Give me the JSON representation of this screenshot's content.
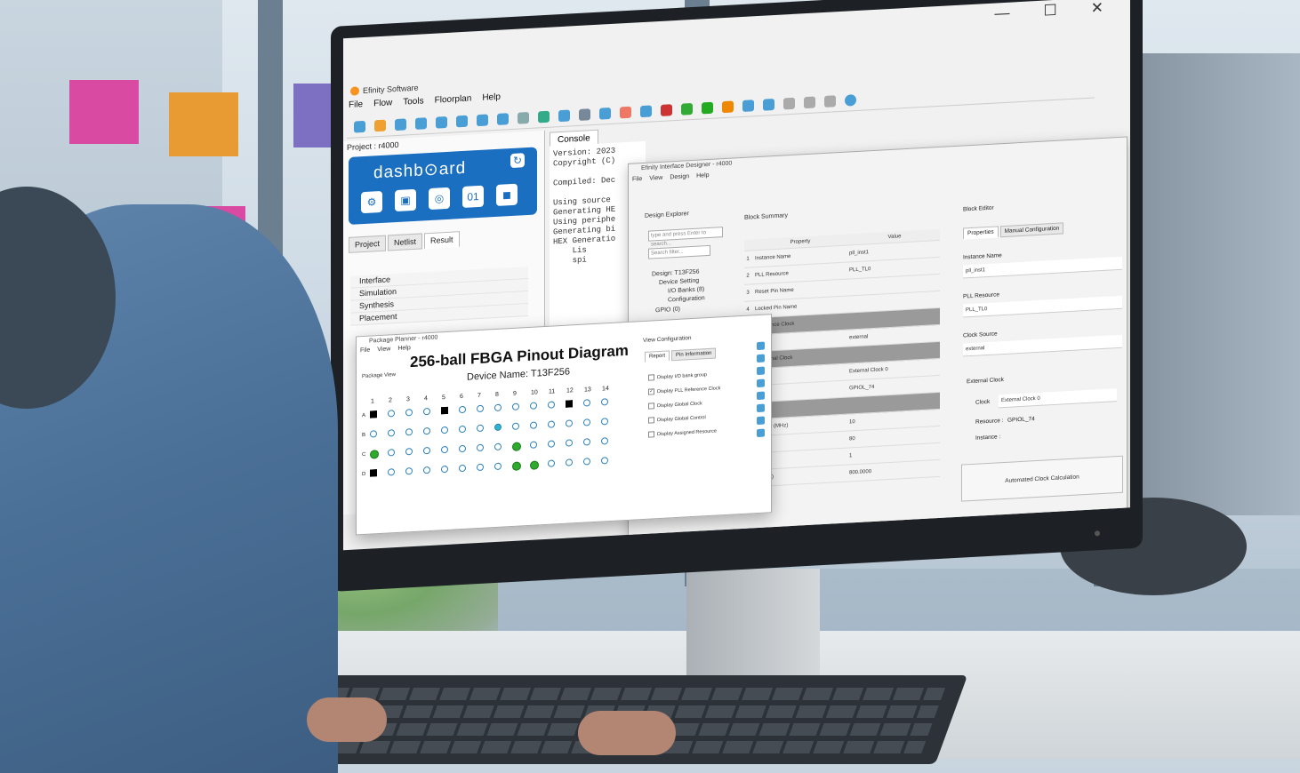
{
  "app": {
    "title": "Efinity Software",
    "menu": [
      "File",
      "Flow",
      "Tools",
      "Floorplan",
      "Help"
    ],
    "window_controls": [
      "—",
      "☐",
      "✕"
    ]
  },
  "project_panel": {
    "label": "Project : r4000",
    "dashboard_title": "dashb⊙ard",
    "tabs": [
      "Project",
      "Netlist",
      "Result"
    ],
    "active_tab": "Result",
    "tree": [
      "Interface",
      "Simulation",
      "Synthesis",
      "Placement"
    ]
  },
  "console": {
    "tab": "Console",
    "lines": [
      "Version: 2023",
      "Copyright (C)",
      "",
      "Compiled: Dec",
      "",
      "Using source",
      "Generating HE",
      "Using periphe",
      "Generating bi",
      "HEX Generatio",
      "    Lis",
      "    spi"
    ]
  },
  "interface_designer": {
    "title": "Efinity Interface Designer - r4000",
    "menu": [
      "File",
      "View",
      "Design",
      "Help"
    ],
    "design_explorer_label": "Design Explorer",
    "search_placeholder": "type and press Enter to search...",
    "search_filter": "Search filter...",
    "tree": [
      "Design: T13F256",
      "Device Setting",
      "I/O Banks (8)",
      "Configuration",
      "GPIO (0)"
    ],
    "block_summary_label": "Block Summary",
    "table_headers": [
      "Property",
      "Value"
    ],
    "rows": [
      {
        "n": "1",
        "prop": "Instance Name",
        "val": "pll_inst1",
        "shaded": false
      },
      {
        "n": "2",
        "prop": "PLL Resource",
        "val": "PLL_TL0",
        "shaded": false
      },
      {
        "n": "3",
        "prop": "Reset Pin Name",
        "val": "",
        "shaded": false
      },
      {
        "n": "4",
        "prop": "Locked Pin Name",
        "val": "",
        "shaded": false
      },
      {
        "n": "",
        "prop": "Reference Clock",
        "val": "",
        "shaded": true
      },
      {
        "n": "",
        "prop": "",
        "val": "external",
        "shaded": false
      },
      {
        "n": "",
        "prop": "- External Clock",
        "val": "",
        "shaded": true
      },
      {
        "n": "",
        "prop": "",
        "val": "External Clock 0",
        "shaded": false
      },
      {
        "n": "",
        "prop": "ce",
        "val": "GPIOL_74",
        "shaded": false
      },
      {
        "n": "",
        "prop": "",
        "val": "",
        "shaded": true
      },
      {
        "n": "",
        "prop": "quency (MHz)",
        "val": "10",
        "shaded": false
      },
      {
        "n": "",
        "prop": "",
        "val": "80",
        "shaded": false
      },
      {
        "n": "",
        "prop": "",
        "val": "1",
        "shaded": false
      },
      {
        "n": "",
        "prop": "y (MHz)",
        "val": "800.0000",
        "shaded": false
      }
    ],
    "block_editor": {
      "label": "Block Editor",
      "tabs": [
        "Properties",
        "Manual Configuration"
      ],
      "instance_name_label": "Instance Name",
      "instance_name": "pll_inst1",
      "pll_resource_label": "PLL Resource",
      "pll_resource": "PLL_TL0",
      "clock_source_label": "Clock Source",
      "clock_source": "external",
      "external_clock_label": "External Clock",
      "clock_label": "Clock",
      "clock_value": "External Clock 0",
      "resource_label": "Resource :",
      "resource_value": "GPIOL_74",
      "instance_label": "Instance :",
      "auto_button": "Automated Clock Calculation"
    }
  },
  "package_planner": {
    "title": "Package Planner - r4000",
    "menu": [
      "File",
      "View",
      "Help"
    ],
    "view_label": "Package View",
    "diagram_title": "256-ball FBGA Pinout Diagram",
    "device_name": "Device Name: T13F256",
    "columns": [
      "1",
      "2",
      "3",
      "4",
      "5",
      "6",
      "7",
      "8",
      "9",
      "10",
      "11",
      "12",
      "13",
      "14"
    ],
    "rows": [
      "A",
      "B",
      "C",
      "D"
    ],
    "view_config": {
      "label": "View Configuration",
      "tabs": [
        "Report",
        "Pin Information"
      ],
      "checks": [
        {
          "label": "Display I/O bank group",
          "checked": false
        },
        {
          "label": "Display PLL Reference Clock",
          "checked": true
        },
        {
          "label": "Display Global Clock",
          "checked": false
        },
        {
          "label": "Display Global Control",
          "checked": false
        },
        {
          "label": "Display Assigned Resource",
          "checked": false
        }
      ]
    }
  },
  "colors": {
    "dashboard_blue": "#1a6fc0",
    "monitor_bezel": "#1d2125",
    "pin_green": "#2eaa2e"
  }
}
